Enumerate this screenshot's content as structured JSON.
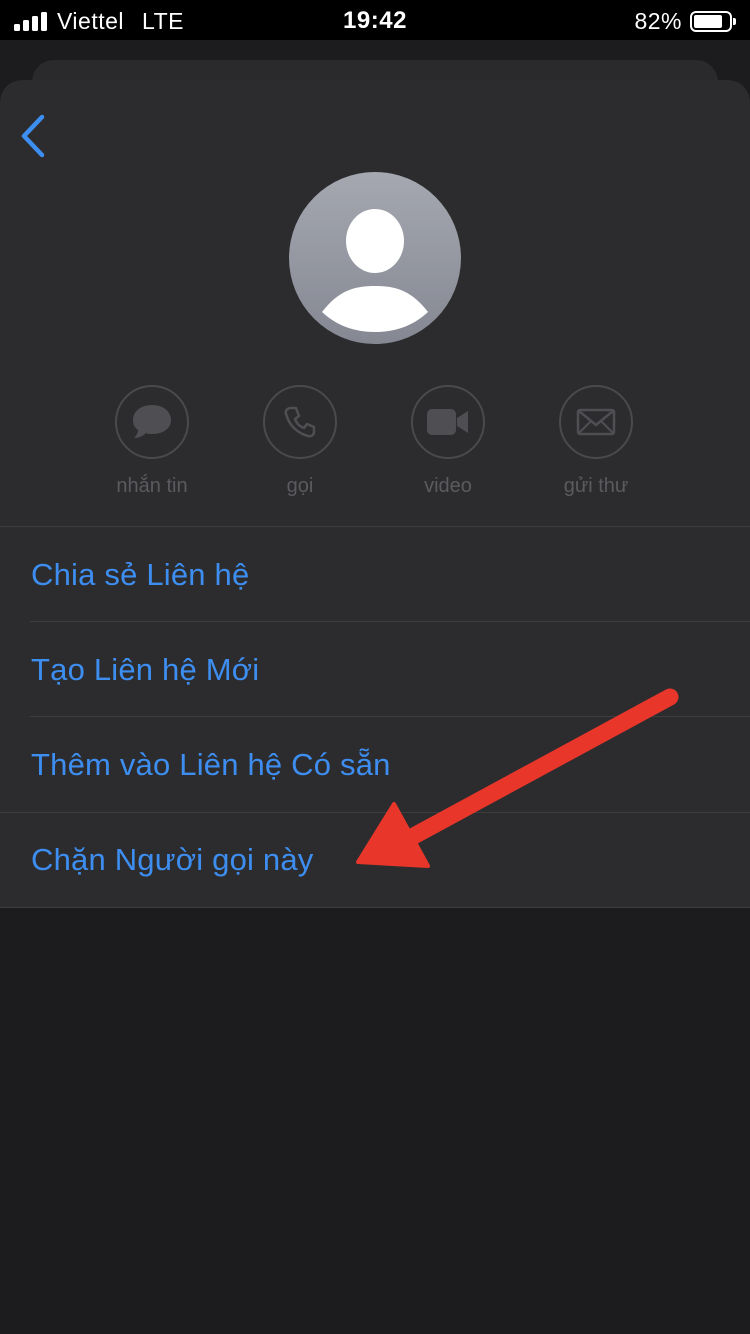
{
  "status_bar": {
    "carrier": "Viettel",
    "network": "LTE",
    "time": "19:42",
    "battery_percent": "82%",
    "battery_level": 0.82,
    "signal_bars": 4
  },
  "actions": [
    {
      "label": "nhắn tin",
      "icon": "message-bubble-icon"
    },
    {
      "label": "gọi",
      "icon": "phone-icon"
    },
    {
      "label": "video",
      "icon": "video-camera-icon"
    },
    {
      "label": "gửi thư",
      "icon": "envelope-icon"
    }
  ],
  "menu": {
    "share_contact": "Chia sẻ Liên hệ",
    "create_new_contact": "Tạo Liên hệ Mới",
    "add_to_existing": "Thêm vào Liên hệ Có sẵn",
    "block_caller": "Chặn Người gọi này"
  },
  "colors": {
    "accent": "#3d8ef0",
    "annotation_arrow": "#e8362b",
    "sheet_background": "#2c2c2e",
    "page_background": "#1c1c1e"
  },
  "icons": {
    "back": "chevron-left-icon",
    "avatar": "person-silhouette-icon"
  }
}
